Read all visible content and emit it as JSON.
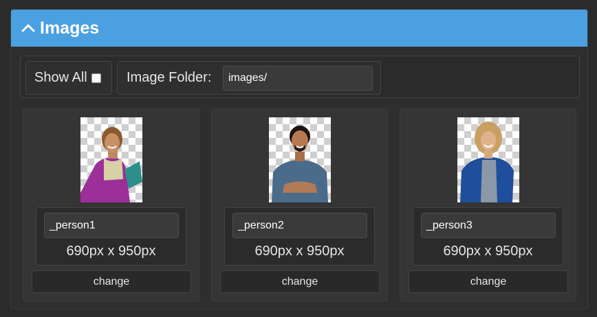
{
  "panel": {
    "title": "Images",
    "header_color": "#4aa0e0",
    "collapse_icon": "chevron-up-icon"
  },
  "toolbar": {
    "show_all_label": "Show All",
    "show_all_checked": false,
    "folder_label": "Image Folder:",
    "folder_value": "images/"
  },
  "images": [
    {
      "name": "_person1",
      "dimensions": "690px x 950px",
      "change_label": "change"
    },
    {
      "name": "_person2",
      "dimensions": "690px x 950px",
      "change_label": "change"
    },
    {
      "name": "_person3",
      "dimensions": "690px x 950px",
      "change_label": "change"
    }
  ]
}
